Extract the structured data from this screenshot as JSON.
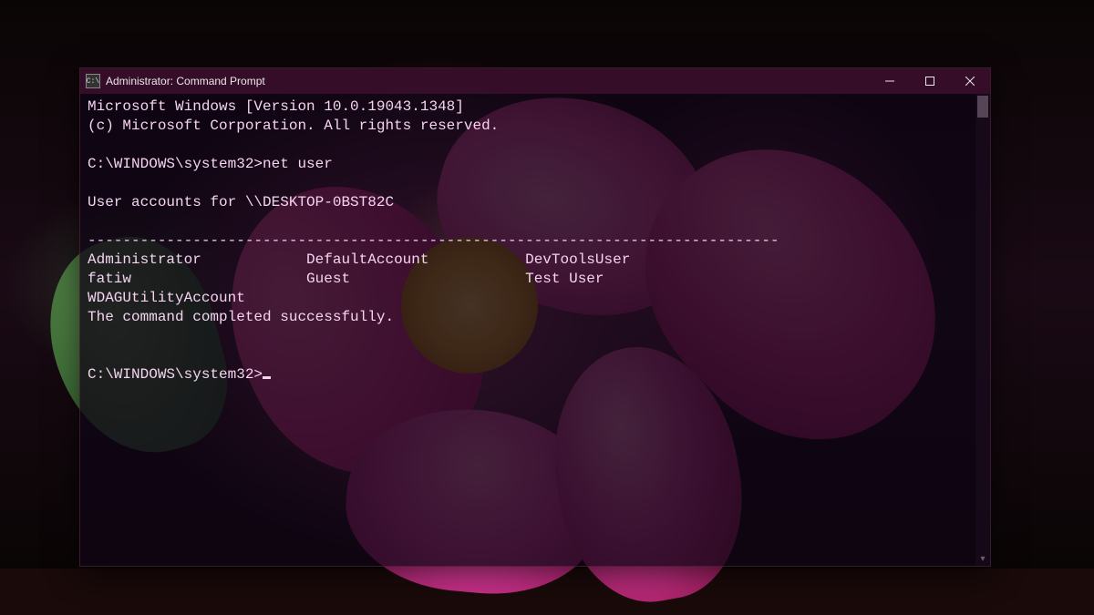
{
  "window": {
    "title": "Administrator: Command Prompt",
    "icon_label": "C:\\"
  },
  "terminal": {
    "header1": "Microsoft Windows [Version 10.0.19043.1348]",
    "header2": "(c) Microsoft Corporation. All rights reserved.",
    "prompt1": "C:\\WINDOWS\\system32>",
    "command1": "net user",
    "accounts_header": "User accounts for \\\\DESKTOP-0BST82C",
    "separator": "-------------------------------------------------------------------------------",
    "users_row1_col1": "Administrator",
    "users_row1_col2": "DefaultAccount",
    "users_row1_col3": "DevToolsUser",
    "users_row2_col1": "fatiw",
    "users_row2_col2": "Guest",
    "users_row2_col3": "Test User",
    "users_row3_col1": "WDAGUtilityAccount",
    "completion": "The command completed successfully.",
    "prompt2": "C:\\WINDOWS\\system32>"
  }
}
